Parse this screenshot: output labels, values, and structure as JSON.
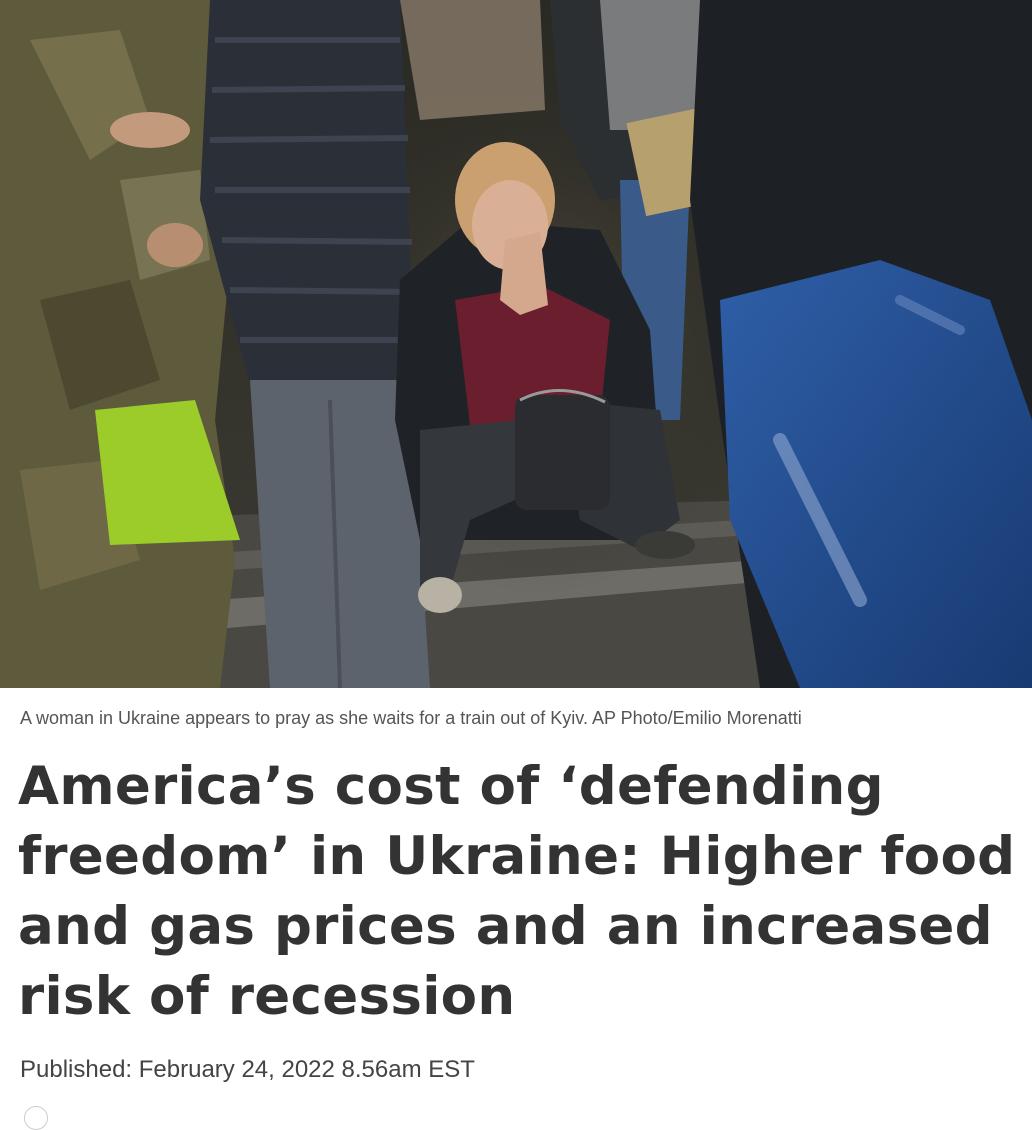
{
  "photo": {
    "caption": "A woman in Ukraine appears to pray as she waits for a train out of Kyiv. AP Photo/Emilio Morenatti"
  },
  "article": {
    "headline": "America’s cost of ‘defending freedom’ in Ukraine: Higher food and gas prices and an increased risk of recession",
    "published_label": "Published:",
    "published_date": "February 24, 2022 8.56am EST"
  }
}
